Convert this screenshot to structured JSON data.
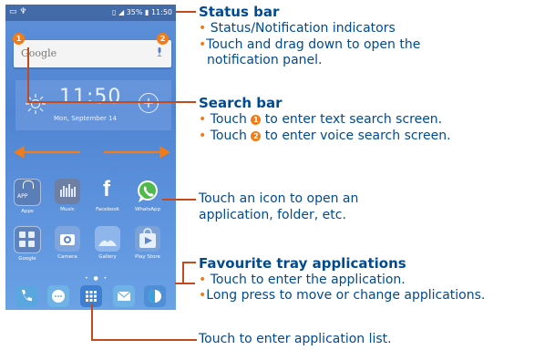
{
  "phone": {
    "status_time": "11:50",
    "battery": "35%",
    "search_logo": "Google",
    "badge1": "1",
    "badge2": "2",
    "clock_time": "11:50",
    "clock_date": "Mon, September 14",
    "apps_row1": [
      {
        "label": "Apps",
        "icon": "apps-folder-icon",
        "glyph": "APP",
        "color": "#5a7fb8"
      },
      {
        "label": "Music",
        "icon": "music-icon",
        "glyph": "",
        "color": "#6d7fa3"
      },
      {
        "label": "Facebook",
        "icon": "facebook-icon",
        "glyph": "f",
        "color": "#4a69a8"
      },
      {
        "label": "WhatsApp",
        "icon": "whatsapp-icon",
        "glyph": "",
        "color": "#4fba4b"
      }
    ],
    "apps_row2": [
      {
        "label": "Google",
        "icon": "google-folder-icon",
        "glyph": "",
        "color": "#5e84bf"
      },
      {
        "label": "Camera",
        "icon": "camera-icon",
        "glyph": "",
        "color": "#7ea5dd"
      },
      {
        "label": "Gallery",
        "icon": "gallery-icon",
        "glyph": "",
        "color": "#8fb6ea"
      },
      {
        "label": "Play Store",
        "icon": "play-store-icon",
        "glyph": "",
        "color": "#7ba2d6"
      }
    ],
    "tray": [
      {
        "icon": "phone-icon",
        "color": "#5aa6df"
      },
      {
        "icon": "messages-icon",
        "color": "#6fb3e6"
      },
      {
        "icon": "app-drawer-icon",
        "color": "#3f7fd0"
      },
      {
        "icon": "email-icon",
        "color": "#6fb3e6"
      },
      {
        "icon": "browser-icon",
        "color": "#4f8fd6"
      }
    ]
  },
  "callouts": {
    "status": {
      "title": "Status bar",
      "lines": [
        "Status/Notification indicators",
        "Touch and drag down to open the",
        "notification panel."
      ]
    },
    "search": {
      "title": "Search bar",
      "line1_pre": "Touch ",
      "line1_num": "1",
      "line1_post": " to enter text search screen.",
      "line2_pre": "Touch ",
      "line2_num": "2",
      "line2_post": " to enter voice search screen."
    },
    "icon": {
      "lines": [
        "Touch an icon to open an",
        "application, folder, etc."
      ]
    },
    "tray": {
      "title": "Favourite tray applications",
      "lines": [
        "Touch to enter the application.",
        "Long press to move or change applications."
      ]
    },
    "list": {
      "line": "Touch to enter application list."
    }
  },
  "colors": {
    "accent": "#f07c1a",
    "text": "#004a8f",
    "line": "#c24a1c"
  }
}
